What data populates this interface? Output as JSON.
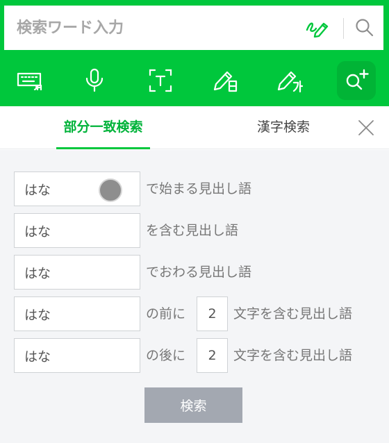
{
  "search": {
    "placeholder": "検索ワード入力",
    "handwrite_icon": "handwriting-pen-icon",
    "search_icon": "magnifier-icon"
  },
  "toolbar": {
    "items": [
      {
        "name": "keyboard-korean",
        "icon": "keyboard-icon"
      },
      {
        "name": "voice-input",
        "icon": "microphone-icon"
      },
      {
        "name": "text-capture",
        "icon": "text-scan-icon"
      },
      {
        "name": "handwrite-japanese",
        "icon": "pen-kanji-icon"
      },
      {
        "name": "handwrite-korean",
        "icon": "pen-hangul-icon"
      },
      {
        "name": "advanced-search",
        "icon": "search-plus-icon",
        "active": true
      }
    ]
  },
  "tabs": {
    "partial": "部分一致検索",
    "kanji": "漢字検索"
  },
  "rows": [
    {
      "value": "はな",
      "label": "で始まる見出し語"
    },
    {
      "value": "はな",
      "label": "を含む見出し語"
    },
    {
      "value": "はな",
      "label": "でおわる見出し語"
    },
    {
      "value": "はな",
      "label_before": "の前に",
      "count": "2",
      "label_after": "文字を含む見出し語"
    },
    {
      "value": "はな",
      "label_before": "の後に",
      "count": "2",
      "label_after": "文字を含む見出し語"
    }
  ],
  "submit": "検索",
  "colors": {
    "brand_green": "#00c73c",
    "active_tab_text": "#00b33a",
    "button_gray": "#a3a8b1"
  }
}
